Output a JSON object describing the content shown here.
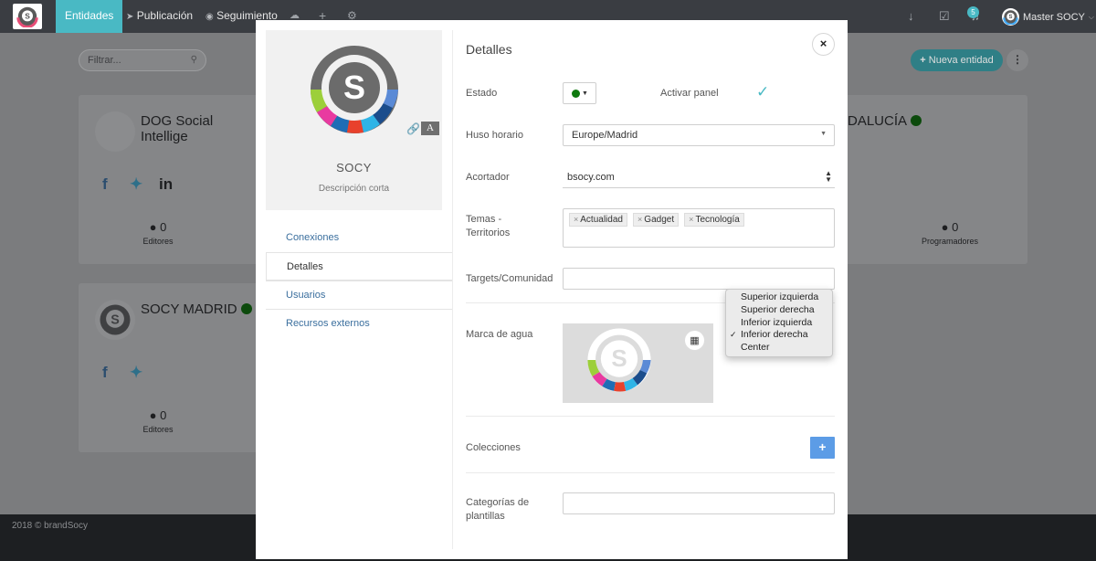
{
  "navbar": {
    "tabs": [
      {
        "label": "Entidades",
        "icon": "",
        "active": true
      },
      {
        "label": "Publicación",
        "icon": "paper-plane-icon",
        "active": false
      },
      {
        "label": "Seguimiento",
        "icon": "eye-icon",
        "active": false
      }
    ],
    "notifications_count": "5",
    "user_name": "Master SOCY"
  },
  "background": {
    "filter_placeholder": "Filtrar...",
    "new_entity_label": "Nueva entidad",
    "cards": [
      {
        "title": "DOG Social Intellige",
        "count": "0",
        "count_label": "Editores",
        "status_color": "#0c4a0c"
      },
      {
        "title": "DALUCÍA",
        "count": "0",
        "count_label": "Programadores",
        "status_color": "#0c4a0c"
      },
      {
        "title": "SOCY MADRID",
        "count": "0",
        "count_label": "Editores",
        "status_color": "#0c4a0c"
      }
    ],
    "footer": "2018 © brandSocy"
  },
  "modal": {
    "entity": {
      "name": "SOCY",
      "description": "Descripción corta"
    },
    "nav": [
      {
        "label": "Conexiones",
        "active": false
      },
      {
        "label": "Detalles",
        "active": true
      },
      {
        "label": "Usuarios",
        "active": false
      },
      {
        "label": "Recursos externos",
        "active": false
      }
    ],
    "title": "Detalles",
    "close_label": "×",
    "fields": {
      "estado_label": "Estado",
      "estado_color": "#0f7a0f",
      "activar_panel_label": "Activar panel",
      "huso_label": "Huso horario",
      "huso_value": "Europe/Madrid",
      "acortador_label": "Acortador",
      "acortador_value": "bsocy.com",
      "temas_label": "Temas - Territorios",
      "temas_tags": [
        "Actualidad",
        "Gadget",
        "Tecnología"
      ],
      "targets_label": "Targets/Comunidad",
      "marca_label": "Marca de agua",
      "colecciones_label": "Colecciones",
      "categorias_label": "Categorías de plantillas"
    },
    "watermark_position": {
      "options": [
        "Superior izquierda",
        "Superior derecha",
        "Inferior izquierda",
        "Inferior derecha",
        "Center"
      ],
      "selected": "Inferior derecha"
    }
  },
  "colors": {
    "accent": "#49b9c4",
    "link": "#3b6f9e",
    "add_button": "#5c9ce6"
  }
}
